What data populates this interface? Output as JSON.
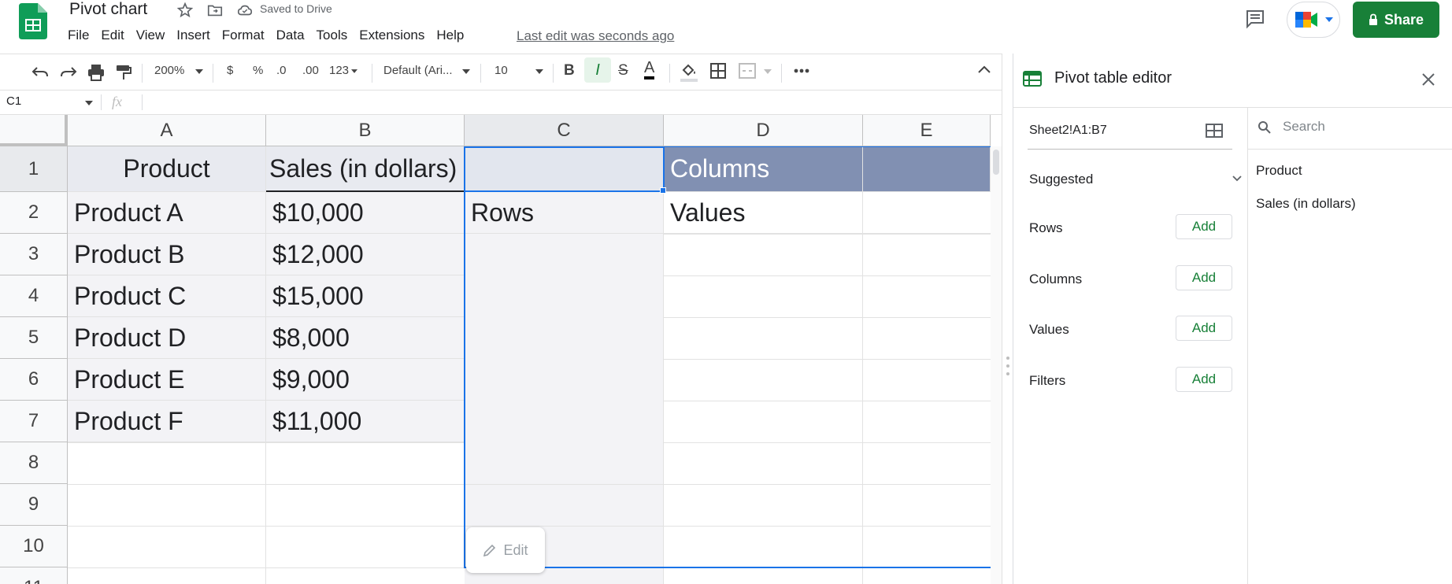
{
  "doc": {
    "title": "Pivot chart",
    "saved_status": "Saved to Drive",
    "last_edit": "Last edit was seconds ago",
    "share_label": "Share"
  },
  "menu": [
    "File",
    "Edit",
    "View",
    "Insert",
    "Format",
    "Data",
    "Tools",
    "Extensions",
    "Help"
  ],
  "toolbar": {
    "zoom": "200%",
    "currency": "$",
    "percent": "%",
    "decimal_decrease": ".0",
    "decimal_increase": ".00",
    "number_format": "123",
    "font": "Default (Ari...",
    "font_size": "10",
    "bold": "B",
    "italic": "I",
    "strike": "S",
    "text_color": "A"
  },
  "formula_bar": {
    "cell_ref": "C1",
    "fx": "fx"
  },
  "columns": [
    "A",
    "B",
    "C",
    "D",
    "E"
  ],
  "rows": [
    "1",
    "2",
    "3",
    "4",
    "5",
    "6",
    "7",
    "8",
    "9",
    "10",
    "11"
  ],
  "cells": {
    "a1": "Product",
    "b1": "Sales (in dollars)",
    "a2": "Product A",
    "b2": "$10,000",
    "a3": "Product B",
    "b3": "$12,000",
    "a4": "Product C",
    "b4": "$15,000",
    "a5": "Product D",
    "b5": "$8,000",
    "a6": "Product E",
    "b6": "$9,000",
    "a7": "Product F",
    "b7": "$11,000",
    "d1": "Columns",
    "c2": "Rows",
    "d2": "Values"
  },
  "edit_chip": "Edit",
  "pivot_editor": {
    "title": "Pivot table editor",
    "range": "Sheet2!A1:B7",
    "suggested": "Suggested",
    "sections": [
      {
        "label": "Rows",
        "add": "Add"
      },
      {
        "label": "Columns",
        "add": "Add"
      },
      {
        "label": "Values",
        "add": "Add"
      },
      {
        "label": "Filters",
        "add": "Add"
      }
    ],
    "search_placeholder": "Search",
    "fields": [
      "Product",
      "Sales (in dollars)"
    ]
  },
  "colors": {
    "share": "#188038",
    "selection": "#1a73e8",
    "pivot_header": "#8190b2"
  }
}
